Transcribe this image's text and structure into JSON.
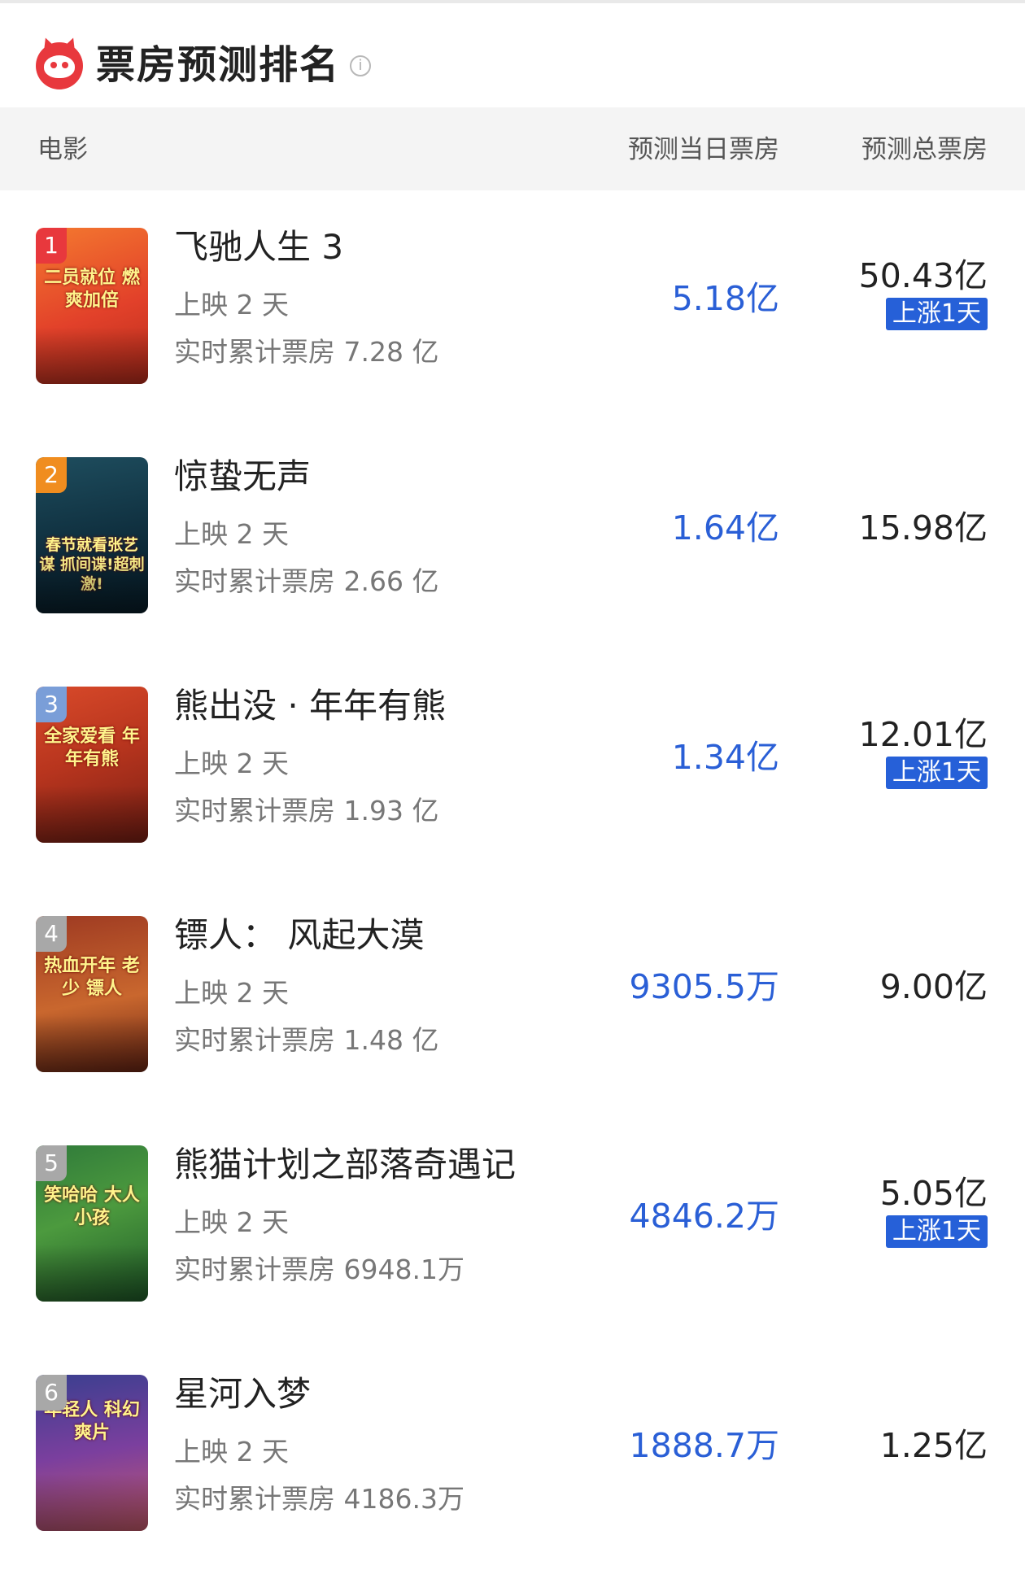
{
  "header": {
    "title": "票房预测排名",
    "info_icon": "i"
  },
  "columns": {
    "movie": "电影",
    "daily": "预测当日票房",
    "total": "预测总票房"
  },
  "colors": {
    "daily_value": "#2a5fd6",
    "rise_badge": "#2660d8",
    "rank_1": "#e8383d",
    "rank_2": "#f08d1f",
    "rank_3": "#7a9ed8",
    "rank_other": "#a8a8a8"
  },
  "movies": [
    {
      "rank": "1",
      "title": "飞驰人生 3",
      "days": "上映 2 天",
      "cumulative": "实时累计票房 7.28 亿",
      "daily": "5.18亿",
      "total": "50.43亿",
      "rise": "上涨1天",
      "poster_text": "二员就位 燃爽加倍"
    },
    {
      "rank": "2",
      "title": "惊蛰无声",
      "days": "上映 2 天",
      "cumulative": "实时累计票房 2.66 亿",
      "daily": "1.64亿",
      "total": "15.98亿",
      "rise": "",
      "poster_text": "春节就看张艺谋 抓间谍!超刺激!"
    },
    {
      "rank": "3",
      "title": "熊出没 · 年年有熊",
      "days": "上映 2 天",
      "cumulative": "实时累计票房 1.93 亿",
      "daily": "1.34亿",
      "total": "12.01亿",
      "rise": "上涨1天",
      "poster_text": "全家爱看 年年有熊"
    },
    {
      "rank": "4",
      "title": "镖人： 风起大漠",
      "days": "上映 2 天",
      "cumulative": "实时累计票房 1.48 亿",
      "daily": "9305.5万",
      "total": "9.00亿",
      "rise": "",
      "poster_text": "热血开年 老少 镖人"
    },
    {
      "rank": "5",
      "title": "熊猫计划之部落奇遇记",
      "days": "上映 2 天",
      "cumulative": "实时累计票房 6948.1万",
      "daily": "4846.2万",
      "total": "5.05亿",
      "rise": "上涨1天",
      "poster_text": "笑哈哈 大人小孩"
    },
    {
      "rank": "6",
      "title": "星河入梦",
      "days": "上映 2 天",
      "cumulative": "实时累计票房 4186.3万",
      "daily": "1888.7万",
      "total": "1.25亿",
      "rise": "",
      "poster_text": "年轻人 科幻爽片"
    }
  ]
}
